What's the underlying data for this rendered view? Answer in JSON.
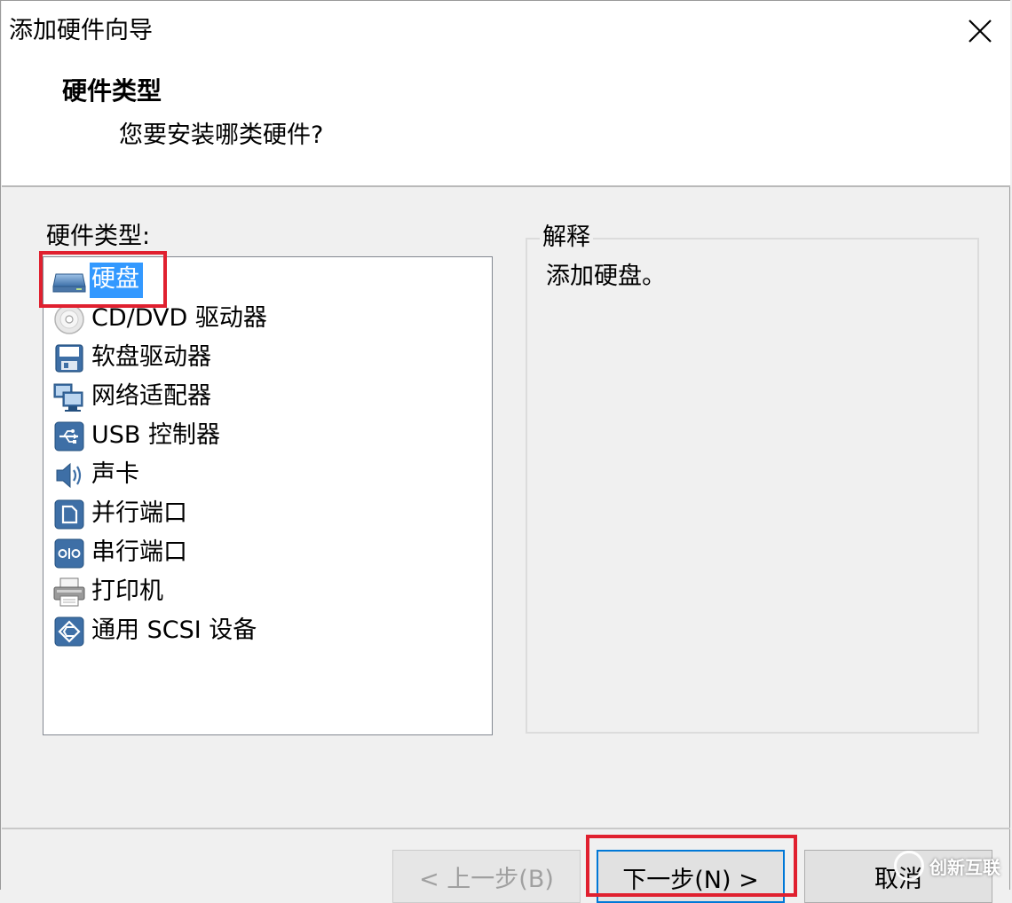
{
  "window": {
    "title": "添加硬件向导"
  },
  "header": {
    "title": "硬件类型",
    "subtitle": "您要安装哪类硬件?"
  },
  "hardware_list": {
    "label": "硬件类型:",
    "items": [
      {
        "label": "硬盘",
        "icon": "hard-disk-icon",
        "selected": true
      },
      {
        "label": "CD/DVD 驱动器",
        "icon": "cd-dvd-icon",
        "selected": false
      },
      {
        "label": "软盘驱动器",
        "icon": "floppy-icon",
        "selected": false
      },
      {
        "label": "网络适配器",
        "icon": "network-adapter-icon",
        "selected": false
      },
      {
        "label": "USB 控制器",
        "icon": "usb-icon",
        "selected": false
      },
      {
        "label": "声卡",
        "icon": "sound-card-icon",
        "selected": false
      },
      {
        "label": "并行端口",
        "icon": "parallel-port-icon",
        "selected": false
      },
      {
        "label": "串行端口",
        "icon": "serial-port-icon",
        "selected": false
      },
      {
        "label": "打印机",
        "icon": "printer-icon",
        "selected": false
      },
      {
        "label": "通用 SCSI 设备",
        "icon": "scsi-icon",
        "selected": false
      }
    ]
  },
  "explanation": {
    "legend": "解释",
    "text": "添加硬盘。"
  },
  "buttons": {
    "back": "< 上一步(B)",
    "next": "下一步(N) >",
    "cancel": "取消"
  },
  "watermark": {
    "text": "创新互联"
  },
  "colors": {
    "selection": "#3399ff",
    "highlight_box": "#e0202f",
    "default_button_border": "#0078d7"
  }
}
